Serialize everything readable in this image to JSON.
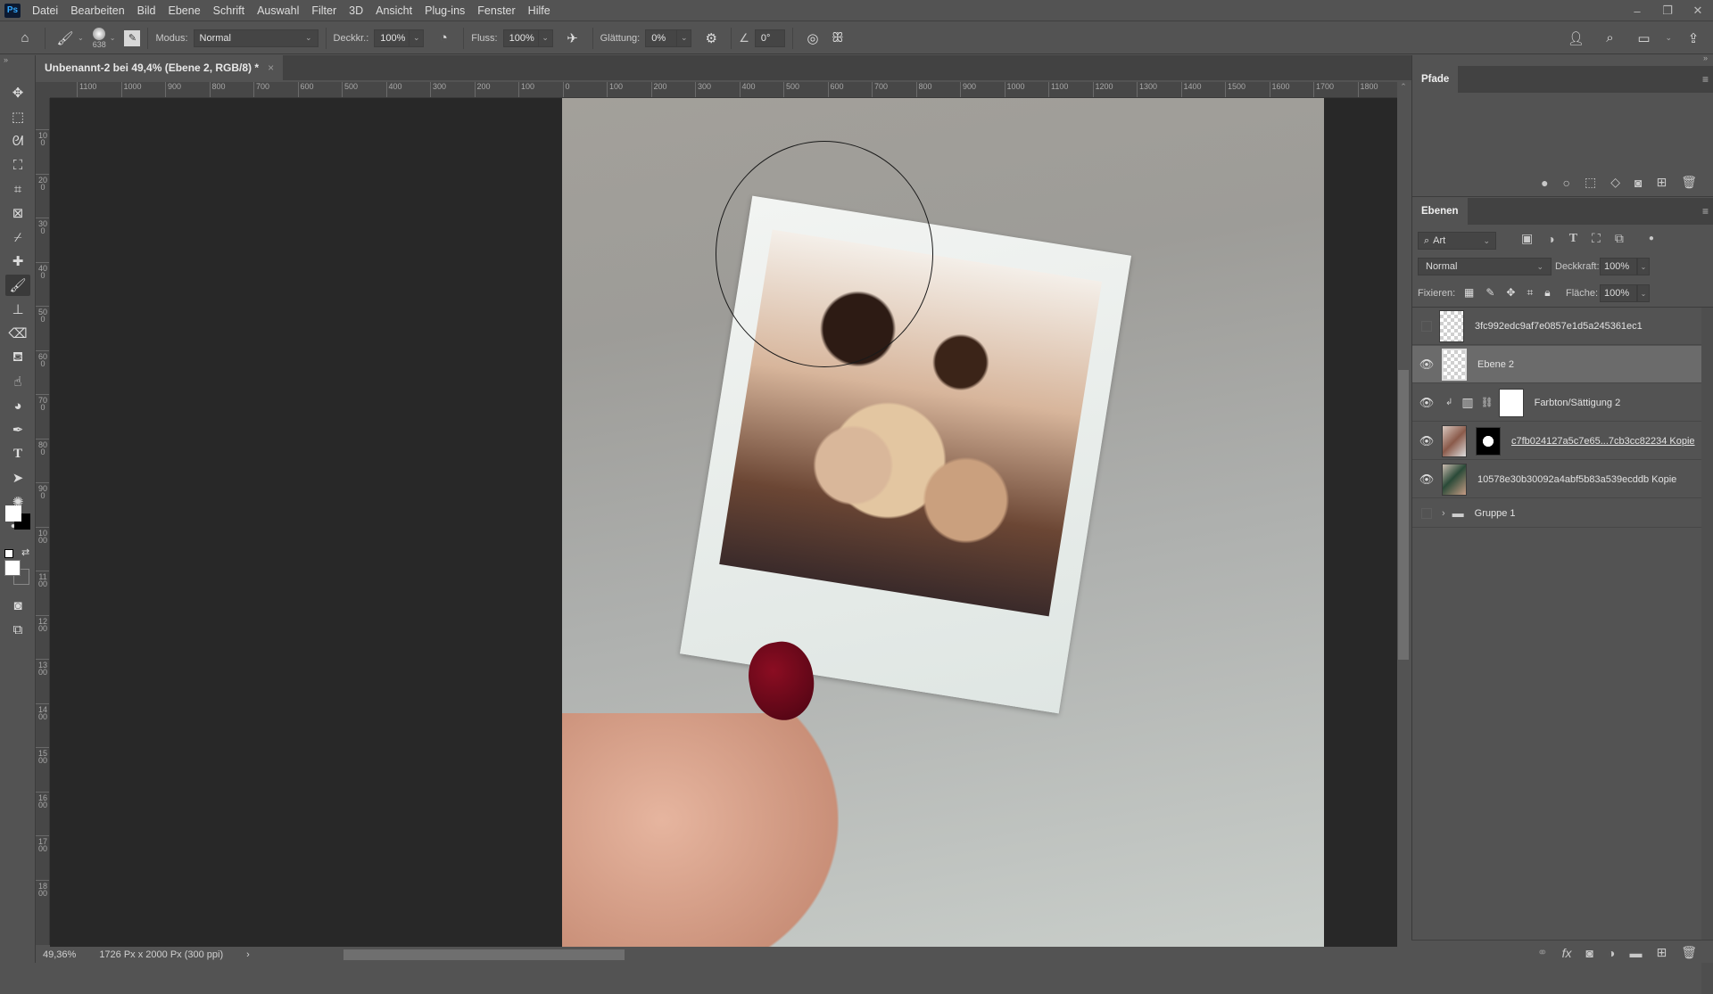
{
  "app": {
    "logo": "Ps"
  },
  "menu": [
    "Datei",
    "Bearbeiten",
    "Bild",
    "Ebene",
    "Schrift",
    "Auswahl",
    "Filter",
    "3D",
    "Ansicht",
    "Plug-ins",
    "Fenster",
    "Hilfe"
  ],
  "window_controls": {
    "minimize": "–",
    "restore": "❐",
    "close": "✕"
  },
  "options": {
    "brush_size": "638",
    "mode_label": "Modus:",
    "mode_value": "Normal",
    "opacity_label": "Deckkr.:",
    "opacity_value": "100%",
    "flow_label": "Fluss:",
    "flow_value": "100%",
    "smoothing_label": "Glättung:",
    "smoothing_value": "0%",
    "angle_value": "0°"
  },
  "document_tab": {
    "title": "Unbenannt-2 bei 49,4% (Ebene 2, RGB/8) *",
    "close": "×"
  },
  "hruler_labels": [
    "1100",
    "1000",
    "900",
    "800",
    "700",
    "600",
    "500",
    "400",
    "300",
    "200",
    "100",
    "0",
    "100",
    "200",
    "300",
    "400",
    "500",
    "600",
    "700",
    "800",
    "900",
    "1000",
    "1100",
    "1200",
    "1300",
    "1400",
    "1500",
    "1600",
    "1700",
    "1800"
  ],
  "vruler_labels": [
    "100",
    "200",
    "300",
    "400",
    "500",
    "600",
    "700",
    "800",
    "900",
    "1000",
    "1100",
    "1200",
    "1300",
    "1400",
    "1500",
    "1600",
    "1700",
    "1800"
  ],
  "status": {
    "zoom": "49,36%",
    "doc_size": "1726 Px x 2000 Px (300 ppi)",
    "arrow": "›"
  },
  "paths_panel": {
    "tab": "Pfade"
  },
  "layers_panel": {
    "tab": "Ebenen",
    "filter_label": "Art",
    "blend_mode": "Normal",
    "opacity_label": "Deckkraft:",
    "opacity_value": "100%",
    "lock_label": "Fixieren:",
    "fill_label": "Fläche:",
    "fill_value": "100%",
    "layers": [
      {
        "name": "3fc992edc9af7e0857e1d5a245361ec1",
        "visible": false,
        "selected": false
      },
      {
        "name": "Ebene 2",
        "visible": true,
        "selected": true
      },
      {
        "name": "Farbton/Sättigung 2",
        "visible": true,
        "selected": false
      },
      {
        "name": "c7fb024127a5c7e65...7cb3cc82234 Kopie",
        "visible": true,
        "selected": false
      },
      {
        "name": "10578e30b30092a4abf5b83a539ecddb Kopie",
        "visible": true,
        "selected": false
      },
      {
        "name": "Gruppe 1",
        "visible": false,
        "selected": false
      }
    ]
  },
  "colors": {
    "foreground": "#ffffff",
    "background": "#000000",
    "nail": "#8b0d22"
  }
}
